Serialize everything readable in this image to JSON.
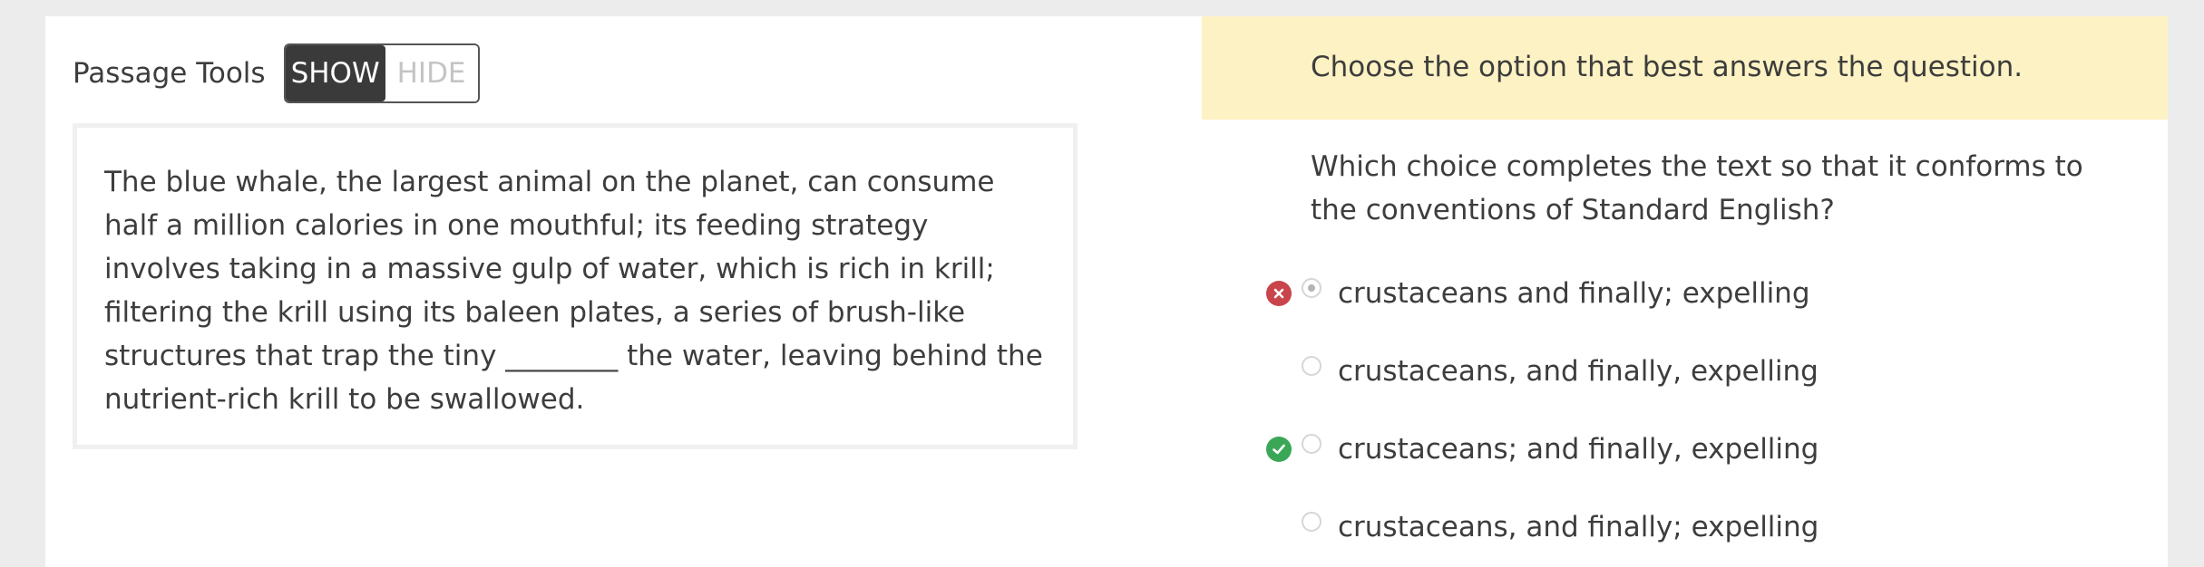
{
  "passage_tools": {
    "label": "Passage Tools",
    "show_label": "SHOW",
    "hide_label": "HIDE"
  },
  "passage": {
    "text": "The blue whale, the largest animal on the planet, can consume half a million calories in one mouthful; its feeding strategy involves taking in a massive gulp of water, which is rich in krill; filtering the krill using its baleen plates, a series of brush-like structures that trap the tiny ________ the water, leaving behind the nutrient-rich krill to be swallowed."
  },
  "instruction": "Choose the option that best answers the question.",
  "question": "Which choice completes the text so that it conforms to the conventions of Standard English?",
  "options": [
    {
      "label": "crustaceans and finally; expelling",
      "selected": true,
      "feedback": "incorrect"
    },
    {
      "label": "crustaceans, and finally, expelling",
      "selected": false,
      "feedback": "none"
    },
    {
      "label": "crustaceans; and finally, expelling",
      "selected": false,
      "feedback": "correct"
    },
    {
      "label": "crustaceans, and finally; expelling",
      "selected": false,
      "feedback": "none"
    }
  ],
  "icons": {
    "incorrect": "x-circle-icon",
    "correct": "check-circle-icon"
  },
  "colors": {
    "instruction_background": "#fdf2c3",
    "incorrect": "#c9444b",
    "correct": "#3aa756",
    "toggle_active": "#3a3a3a"
  }
}
